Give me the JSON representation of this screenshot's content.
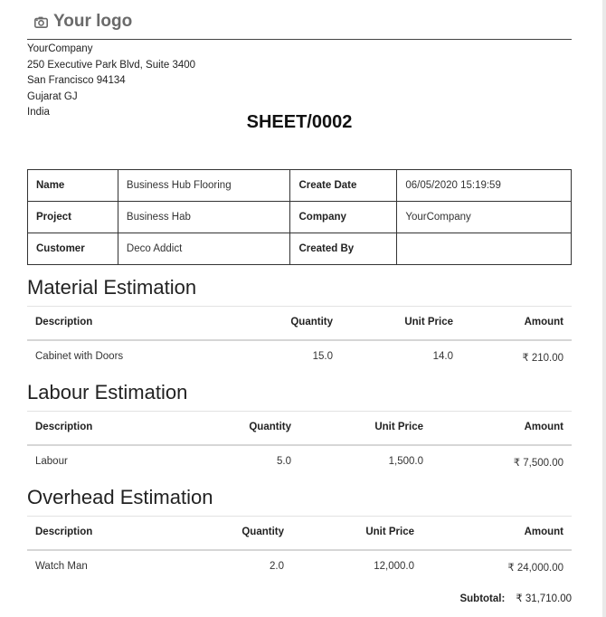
{
  "logo": {
    "text": "Your logo",
    "icon": "camera-icon"
  },
  "company": {
    "name": "YourCompany",
    "address1": "250 Executive Park Blvd, Suite 3400",
    "city": "San Francisco 94134",
    "state": "Gujarat GJ",
    "country": "India"
  },
  "title": "SHEET/0002",
  "info": {
    "name_label": "Name",
    "name_value": "Business Hub Flooring",
    "create_date_label": "Create Date",
    "create_date_value": "06/05/2020 15:19:59",
    "project_label": "Project",
    "project_value": "Business Hab",
    "company_label": "Company",
    "company_value": "YourCompany",
    "customer_label": "Customer",
    "customer_value": "Deco Addict",
    "created_by_label": "Created By",
    "created_by_value": ""
  },
  "material": {
    "title": "Material Estimation",
    "headers": {
      "description": "Description",
      "quantity": "Quantity",
      "unit_price": "Unit Price",
      "amount": "Amount"
    },
    "rows": [
      {
        "description": "Cabinet with Doors",
        "quantity": "15.0",
        "unit_price": "14.0",
        "amount": "₹ 210.00"
      }
    ]
  },
  "labour": {
    "title": "Labour Estimation",
    "headers": {
      "description": "Description",
      "quantity": "Quantity",
      "unit_price": "Unit Price",
      "amount": "Amount"
    },
    "rows": [
      {
        "description": "Labour",
        "quantity": "5.0",
        "unit_price": "1,500.0",
        "amount": "₹ 7,500.00"
      }
    ]
  },
  "overhead": {
    "title": "Overhead Estimation",
    "headers": {
      "description": "Description",
      "quantity": "Quantity",
      "unit_price": "Unit Price",
      "amount": "Amount"
    },
    "rows": [
      {
        "description": "Watch Man",
        "quantity": "2.0",
        "unit_price": "12,000.0",
        "amount": "₹ 24,000.00"
      }
    ]
  },
  "subtotal": {
    "label": "Subtotal:",
    "value": "₹ 31,710.00"
  }
}
